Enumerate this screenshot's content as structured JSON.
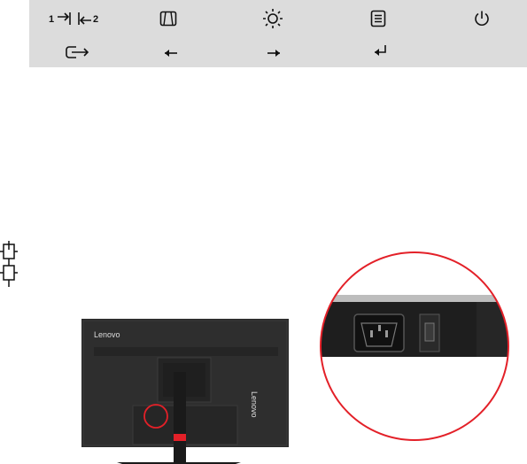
{
  "panel": {
    "input_switch": {
      "left_num": "1",
      "right_num": "2"
    },
    "icons": [
      "input-switch-icon",
      "aspect-ratio-icon",
      "brightness-icon",
      "menu-icon",
      "power-icon",
      "exit-icon",
      "left-arrow-icon",
      "right-arrow-icon",
      "enter-icon"
    ]
  },
  "monitor": {
    "brand": "Lenovo",
    "watermark": "Lenovo"
  },
  "colors": {
    "panel_bg": "#dcdcdc",
    "highlight_red": "#e32028",
    "monitor_body": "#2b2b2b"
  }
}
